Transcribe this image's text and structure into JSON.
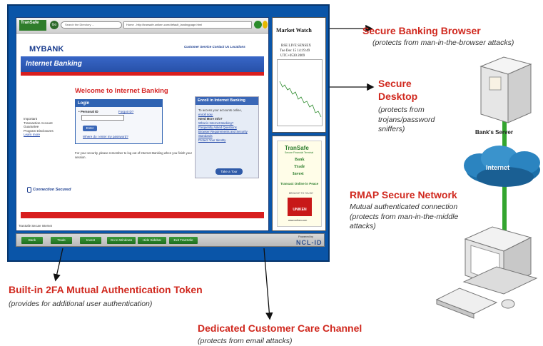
{
  "browser": {
    "logo_text": "TranSafe",
    "go_label": "Go",
    "search_placeholder": "Search the Directory ...",
    "url_text": "Home - http://transafe.uniken.com/default_landingpage.html"
  },
  "bank_page": {
    "brand": "MYBANK",
    "top_links": "Customer Service      Contact Us      Locations",
    "banner_title": "Internet Banking",
    "welcome": "Welcome to Internet Banking",
    "login": {
      "header": "Login",
      "personal_id_label": "• Personal ID",
      "forgot_id": "Forgot ID?",
      "enter_button": "Enter",
      "forgot_password": "Where do I enter my password?"
    },
    "security_note": "For your security, please remember to log out of Internet Banking when you finish your session.",
    "left_links": {
      "line1": "Important",
      "line2": "Transaction Account Guarantee",
      "line3": "Program Disclosures",
      "learn_more": "Learn more"
    },
    "connection": "Connection Secured",
    "enroll": {
      "header": "Enroll in Internet Banking",
      "intro": "To access your accounts online,",
      "enroll_now": "enroll now.",
      "need_info": "Need More Info?",
      "link1": "What is Internet Banking?",
      "link2": "Frequently Asked Questions",
      "link3": "Browser Requirements and Security Standards",
      "link4": "Protect Your Identity",
      "tour_button": "Take a Tour"
    },
    "status_bar": "TranSafe Secure Internet"
  },
  "bottom_bar": {
    "buttons": [
      "Bank",
      "Trade",
      "Invest",
      "Go to Windows",
      "Hide Sidebar",
      "Exit TranSafe"
    ],
    "powered": "Powered by",
    "ncl": "NCL-ID"
  },
  "market_watch": {
    "title": "Market Watch",
    "line1": "BSE LIVE SENSEX",
    "line2": "Tue Dec 15 14:19:49",
    "line3": "UTC+0530 2009"
  },
  "transafe_panel": {
    "logo": "TranSafe",
    "tagline": "Secure Financial Terminal",
    "bank": "Bank",
    "trade": "Trade",
    "invest": "Invest",
    "peace": "Transact Online in Peace",
    "brought": "BROUGHT TO YOU BY",
    "uniken": "UNIKEN",
    "url": "www.uniken.com"
  },
  "annotations": {
    "secure_browser_title": "Secure Banking Browser",
    "secure_browser_desc": "(protects from  man-in-the-browser attacks)",
    "secure_desktop_title": "Secure Desktop",
    "secure_desktop_desc": "(protects from trojans/password sniffers)",
    "rmap_title": "RMAP Secure Network",
    "rmap_desc": "Mutual authenticated connection (protects from man-in-the-middle attacks)",
    "twofa_title": "Built-in 2FA Mutual Authentication Token",
    "twofa_desc": "(provides for additional user authentication)",
    "care_title": "Dedicated Customer Care Channel",
    "care_desc": "(protects from email attacks)",
    "server_label": "Bank's Server",
    "internet_label": "Internet"
  },
  "colors": {
    "frame_blue": "#0a55a8",
    "accent_red": "#d0281e",
    "link_green": "#33a52f"
  }
}
